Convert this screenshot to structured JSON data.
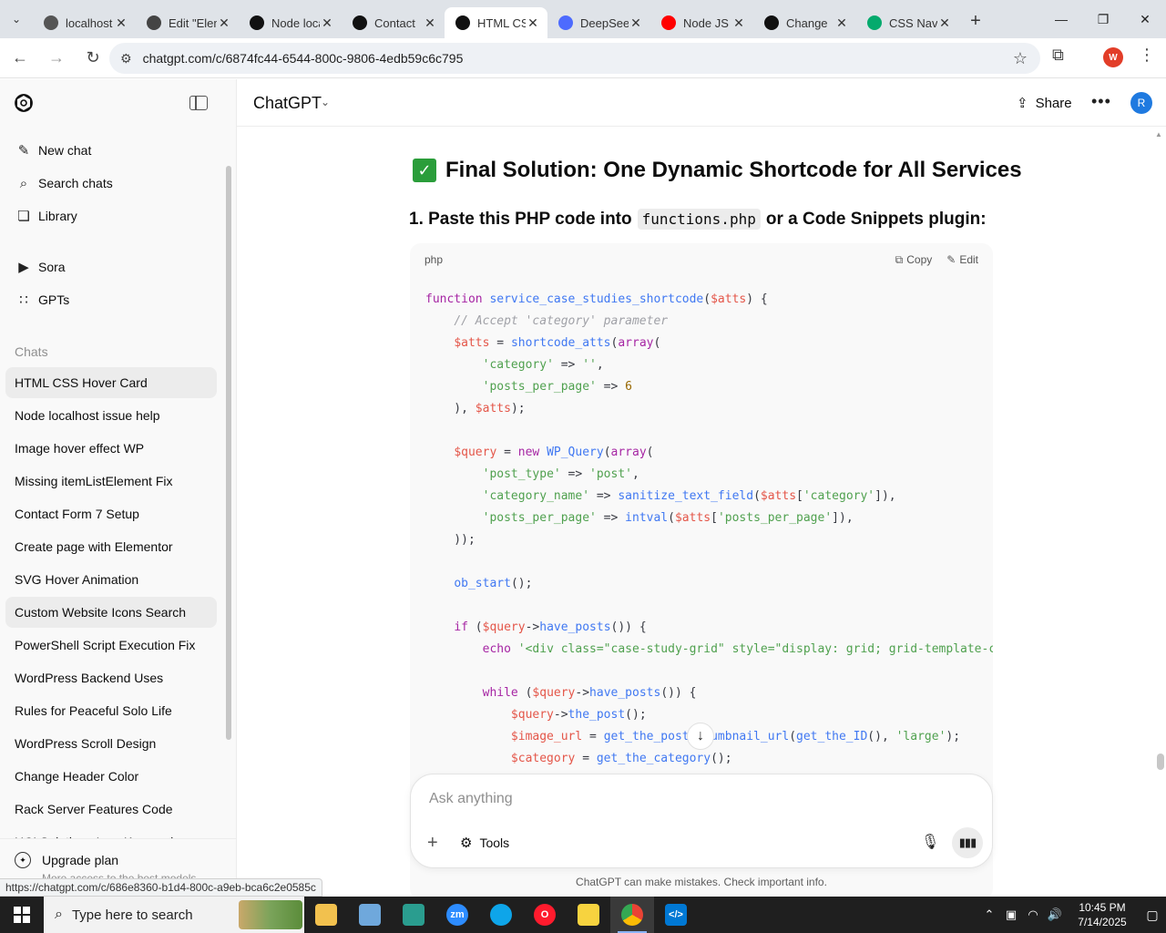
{
  "browser": {
    "tabs": [
      {
        "title": "localhost",
        "favicon": "x-box-icon",
        "color": "#555555"
      },
      {
        "title": "Edit \"Elementor\"",
        "favicon": "globe-icon",
        "color": "#444444"
      },
      {
        "title": "Node localhost",
        "favicon": "openai-icon",
        "color": "#111111"
      },
      {
        "title": "Contact",
        "favicon": "openai-icon",
        "color": "#111111"
      },
      {
        "title": "HTML CSS",
        "favicon": "openai-icon",
        "color": "#111111",
        "active": true
      },
      {
        "title": "DeepSeek",
        "favicon": "deepseek-icon",
        "color": "#4d6bfe"
      },
      {
        "title": "Node JS",
        "favicon": "youtube-icon",
        "color": "#ff0000"
      },
      {
        "title": "Change",
        "favicon": "openai-icon",
        "color": "#111111"
      },
      {
        "title": "CSS Nav",
        "favicon": "w3-icon",
        "color": "#04aa6d"
      }
    ],
    "url": "chatgpt.com/c/6874fc44-6544-800c-9806-4edb59c6c795",
    "profile_initial": "W",
    "status_url": "https://chatgpt.com/c/686e8360-b1d4-800c-a9eb-bca6c2e0585c"
  },
  "sidebar": {
    "nav": [
      {
        "label": "New chat",
        "icon": "edit-icon"
      },
      {
        "label": "Search chats",
        "icon": "search-icon"
      },
      {
        "label": "Library",
        "icon": "library-icon"
      },
      {
        "label": "Sora",
        "icon": "sora-icon"
      },
      {
        "label": "GPTs",
        "icon": "gpts-icon"
      }
    ],
    "section_title": "Chats",
    "chats": [
      "HTML CSS Hover Card",
      "Node localhost issue help",
      "Image hover effect WP",
      "Missing itemListElement Fix",
      "Contact Form 7 Setup",
      "Create page with Elementor",
      "SVG Hover Animation",
      "Custom Website Icons Search",
      "PowerShell Script Execution Fix",
      "WordPress Backend Uses",
      "Rules for Peaceful Solo Life",
      "WordPress Scroll Design",
      "Change Header Color",
      "Rack Server Features Code",
      "HCI Solutions Icon Keywords"
    ],
    "upgrade_label": "Upgrade plan",
    "upgrade_sub": "More access to the best models"
  },
  "header": {
    "model": "ChatGPT",
    "share_label": "Share",
    "avatar_initial": "R"
  },
  "message": {
    "heading": "Final Solution: One Dynamic Shortcode for All Services",
    "step_prefix": "1. Paste this PHP code into",
    "step_code": "functions.php",
    "step_suffix": "or a Code Snippets plugin:",
    "code_lang": "php",
    "copy_label": "Copy",
    "edit_label": "Edit"
  },
  "composer": {
    "placeholder": "Ask anything",
    "tools_label": "Tools"
  },
  "disclaimer": "ChatGPT can make mistakes. Check important info.",
  "taskbar": {
    "search_placeholder": "Type here to search",
    "time": "10:45 PM",
    "date": "7/14/2025"
  }
}
